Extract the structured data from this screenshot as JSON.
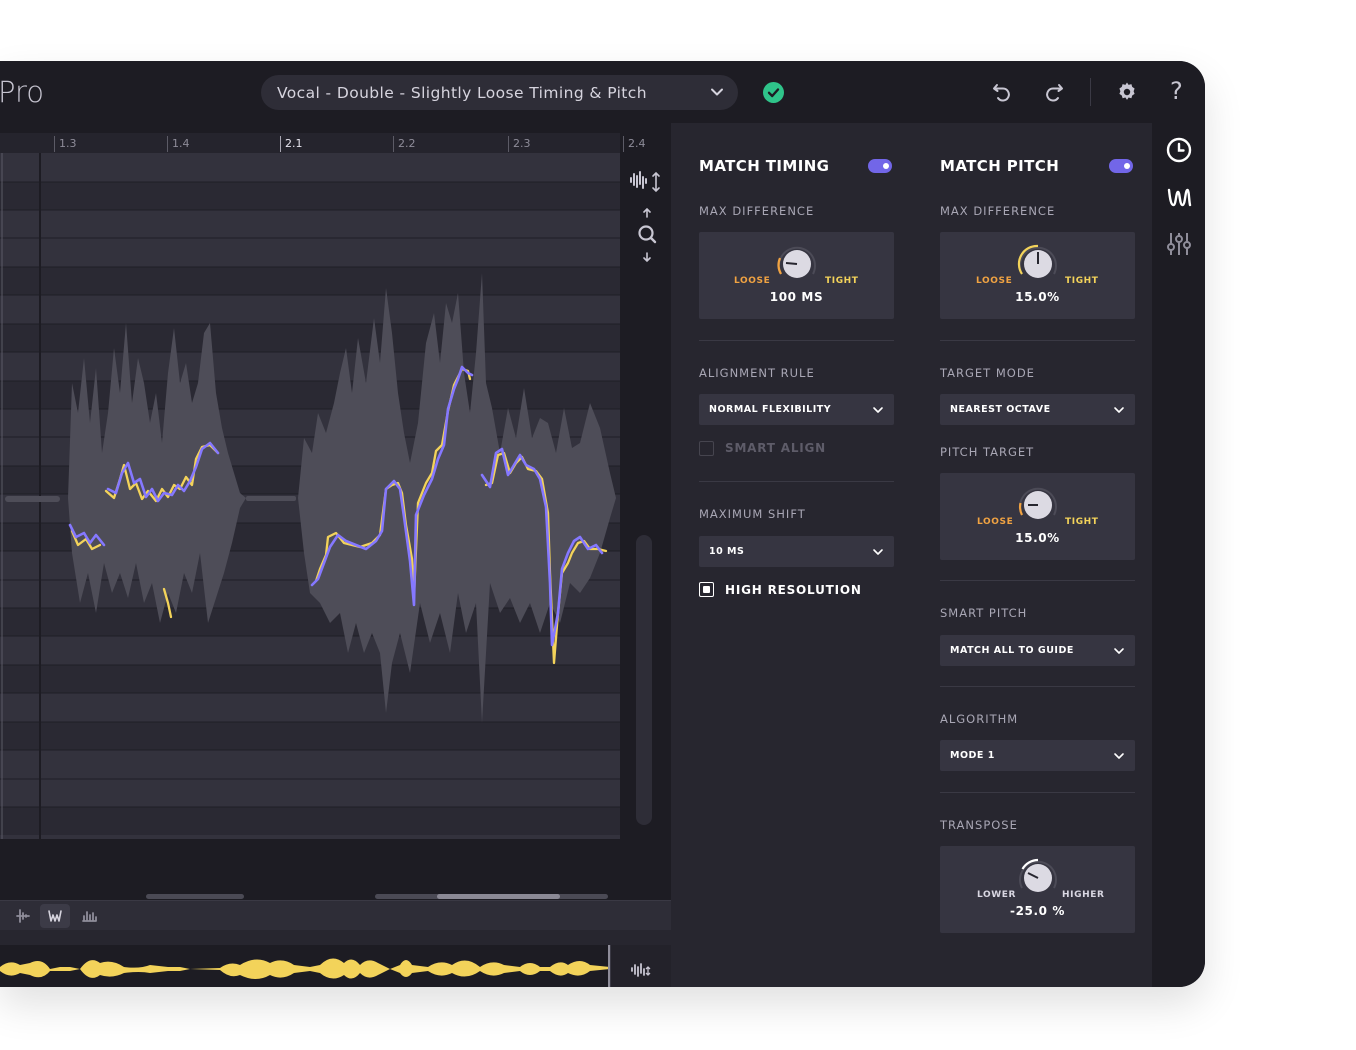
{
  "app": {
    "brand": "Pro"
  },
  "header": {
    "preset": "Vocal - Double - Slightly Loose Timing & Pitch",
    "icons": [
      "undo-icon",
      "redo-icon",
      "gear-icon",
      "help-icon"
    ],
    "help_label": "?"
  },
  "rail": {
    "icons": [
      "clock-icon",
      "waveform-w-icon",
      "sliders-icon"
    ]
  },
  "ruler": {
    "ticks": [
      "1.3",
      "1.4",
      "2.1",
      "2.2",
      "2.3",
      "2.4"
    ],
    "current": "2.1"
  },
  "colors": {
    "accent": "#7266e8",
    "guide": "#f3d35a",
    "dub": "#8578ff",
    "warn": "#f1a342"
  },
  "timing": {
    "title": "MATCH TIMING",
    "enabled": true,
    "max_diff_label": "MAX DIFFERENCE",
    "knob": {
      "low": "LOOSE",
      "high": "TIGHT",
      "value": "100 MS"
    },
    "alignment_label": "ALIGNMENT RULE",
    "alignment_value": "NORMAL FLEXIBILITY",
    "smart_align": {
      "label": "SMART ALIGN",
      "checked": false
    },
    "max_shift_label": "MAXIMUM SHIFT",
    "max_shift_value": "10 MS",
    "high_res": {
      "label": "HIGH RESOLUTION",
      "checked": true
    }
  },
  "pitch": {
    "title": "MATCH PITCH",
    "enabled": true,
    "max_diff_label": "MAX DIFFERENCE",
    "knob": {
      "low": "LOOSE",
      "high": "TIGHT",
      "value": "15.0%"
    },
    "target_mode_label": "TARGET MODE",
    "target_mode_value": "NEAREST OCTAVE",
    "pitch_target_label": "PITCH TARGET",
    "pitch_target_knob": {
      "low": "LOOSE",
      "high": "TIGHT",
      "value": "15.0%"
    },
    "smart_pitch_label": "SMART PITCH",
    "smart_pitch_value": "MATCH ALL TO GUIDE",
    "algorithm_label": "ALGORITHM",
    "algorithm_value": "MODE 1",
    "transpose_label": "TRANSPOSE",
    "transpose_knob": {
      "low": "LOWER",
      "high": "HIGHER",
      "value": "-25.0 %"
    }
  }
}
